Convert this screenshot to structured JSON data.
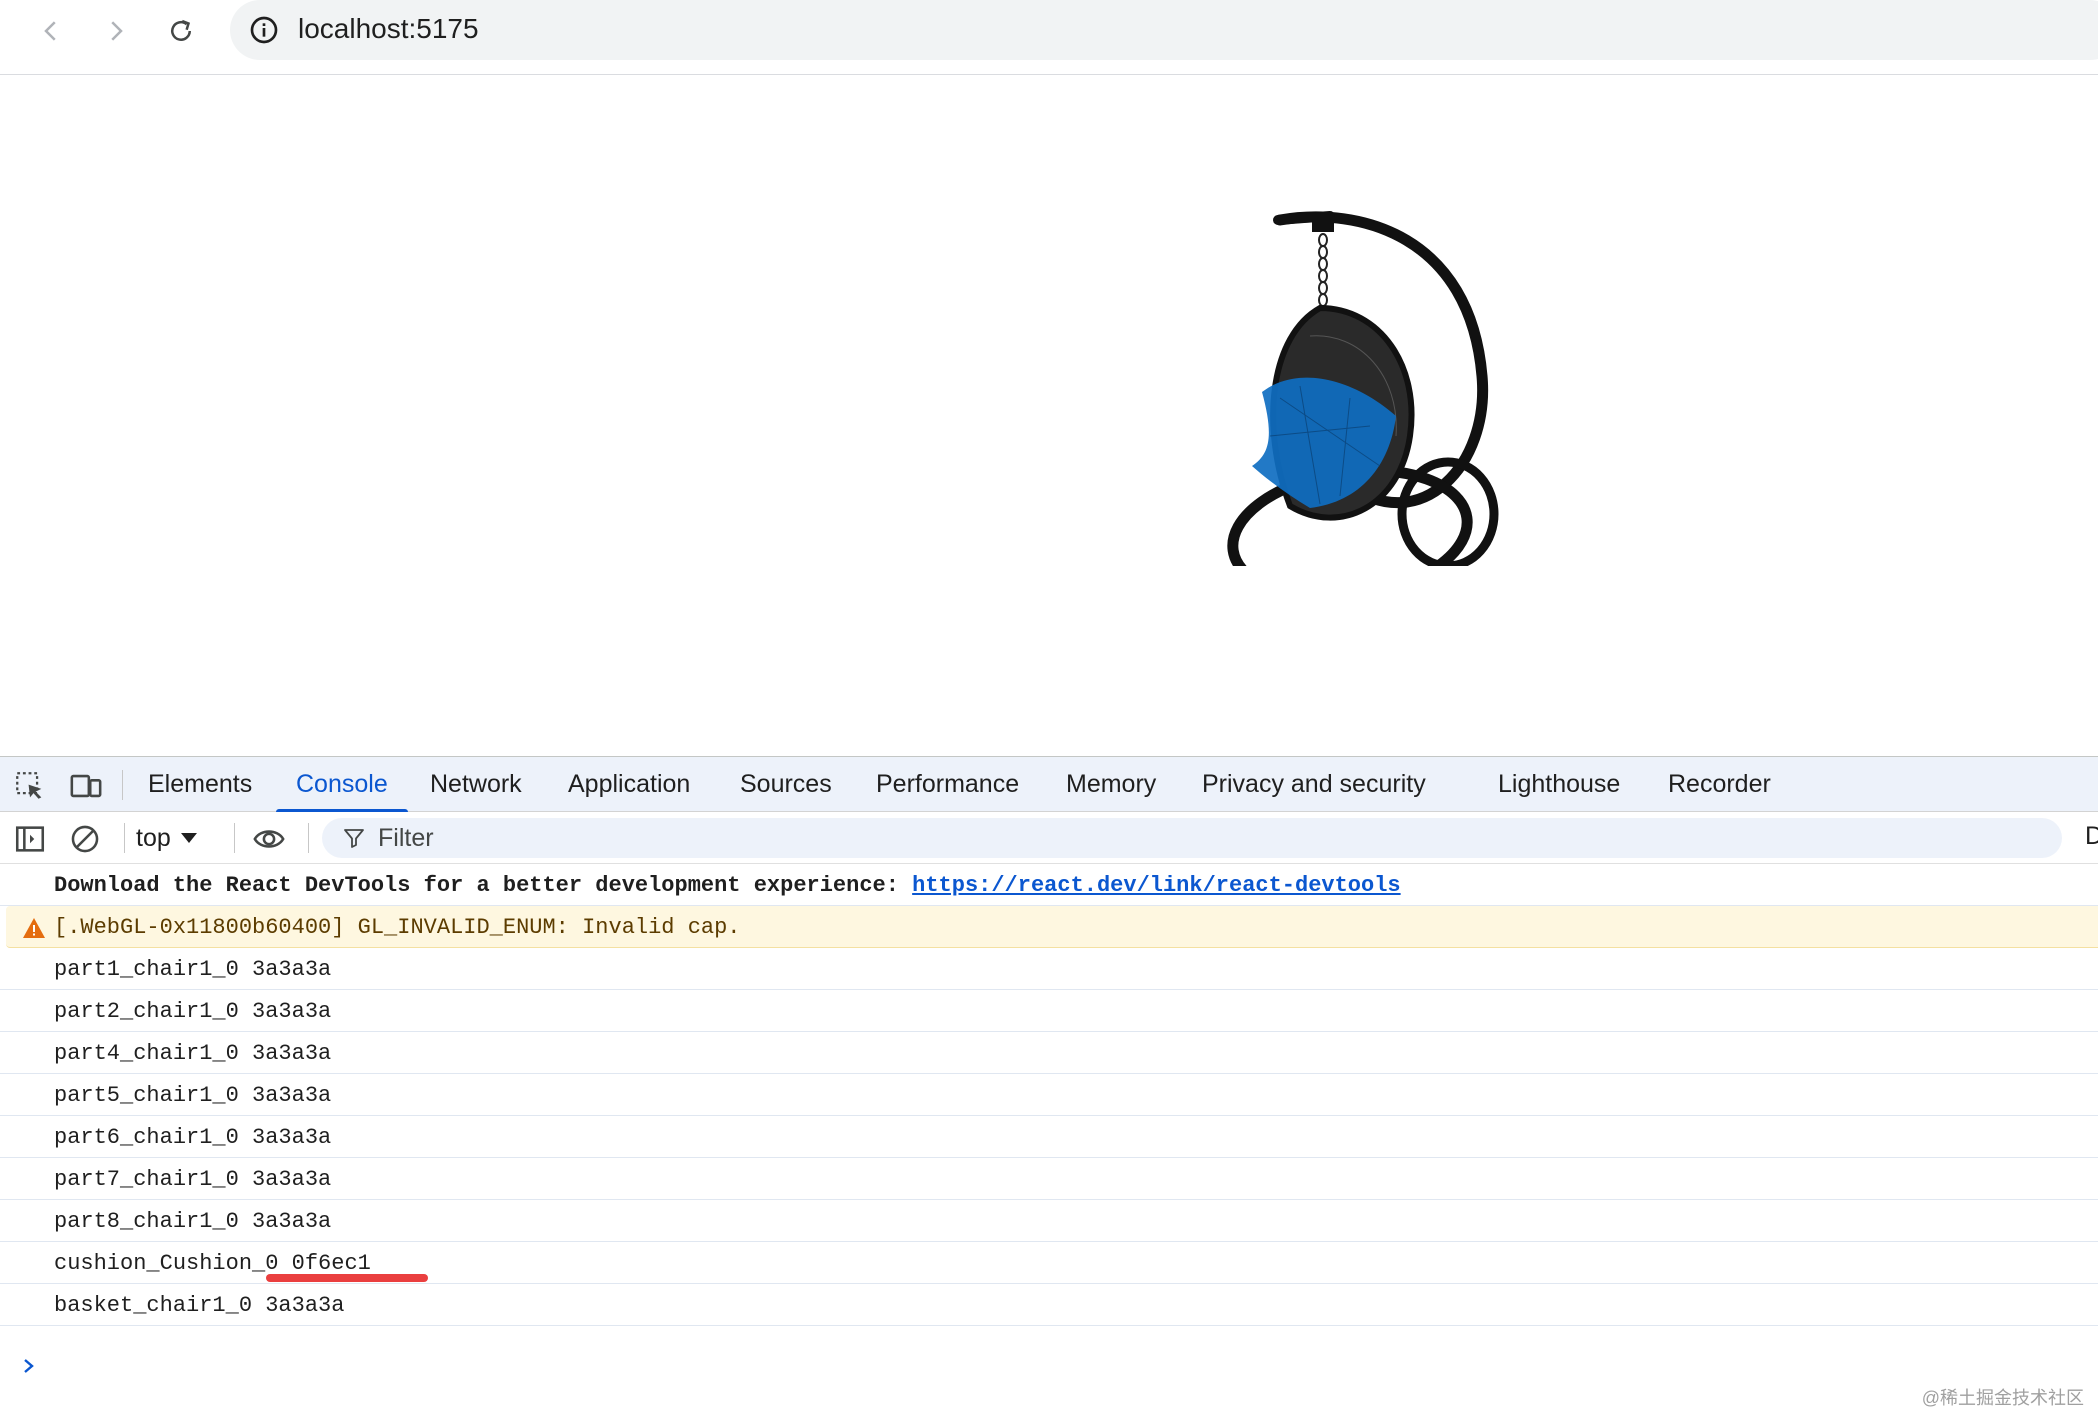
{
  "browser": {
    "url": "localhost:5175",
    "nav": {
      "back_icon": "chevron-left-icon",
      "forward_icon": "chevron-right-icon",
      "reload_icon": "reload-icon",
      "site_info_icon": "info-icon"
    }
  },
  "viewport": {
    "model_description_icon": "hanging-egg-chair",
    "colors": {
      "frame": "#111111",
      "cushion": "#0f6ec1"
    }
  },
  "devtools": {
    "tool_icons": [
      "inspect-element-icon",
      "device-toolbar-icon"
    ],
    "tabs": [
      {
        "label": "Elements",
        "active": false
      },
      {
        "label": "Console",
        "active": true
      },
      {
        "label": "Network",
        "active": false
      },
      {
        "label": "Application",
        "active": false
      },
      {
        "label": "Sources",
        "active": false
      },
      {
        "label": "Performance",
        "active": false
      },
      {
        "label": "Memory",
        "active": false
      },
      {
        "label": "Privacy and security",
        "active": false
      },
      {
        "label": "Lighthouse",
        "active": false
      },
      {
        "label": "Recorder",
        "active": false
      }
    ],
    "console_bar": {
      "context": "top",
      "filter_placeholder": "Filter",
      "truncated_label": "D"
    },
    "log": {
      "info_text": "Download the React DevTools for a better development experience: ",
      "info_link": "https://react.dev/link/react-devtools",
      "warning": "[.WebGL-0x11800b60400] GL_INVALID_ENUM: Invalid cap.",
      "entries": [
        "part1_chair1_0 3a3a3a",
        "part2_chair1_0 3a3a3a",
        "part4_chair1_0 3a3a3a",
        "part5_chair1_0 3a3a3a",
        "part6_chair1_0 3a3a3a",
        "part7_chair1_0 3a3a3a",
        "part8_chair1_0 3a3a3a",
        "cushion_Cushion_0 0f6ec1",
        "basket_chair1_0 3a3a3a"
      ]
    },
    "colors": {
      "accent": "#0b57d0",
      "warning_bg": "#fef7e0",
      "highlight_mark": "#ea3f3f"
    }
  },
  "watermark": "@稀土掘金技术社区"
}
